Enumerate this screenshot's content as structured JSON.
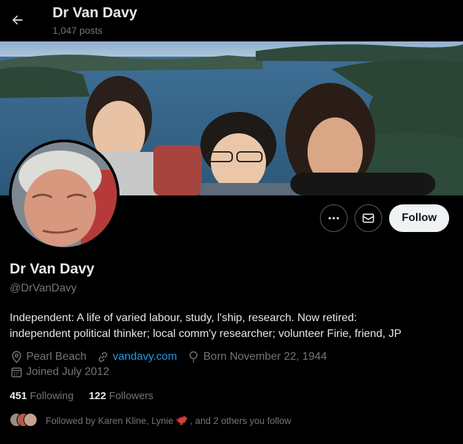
{
  "header": {
    "title": "Dr Van Davy",
    "post_count": "1,047 posts"
  },
  "profile": {
    "name": "Dr Van Davy",
    "handle": "@DrVanDavy",
    "bio_line1": "Independent: A life of varied labour, study, l'ship, research. Now retired:",
    "bio_line2": "independent political thinker; local comm'y researcher; volunteer Firie, friend, JP",
    "location": "Pearl Beach",
    "website": "vandavy.com",
    "birthday": "Born November 22, 1944",
    "joined": "Joined July 2012"
  },
  "actions": {
    "follow_label": "Follow"
  },
  "stats": {
    "following_count": "451",
    "following_label": "Following",
    "followers_count": "122",
    "followers_label": "Followers"
  },
  "followed_by": {
    "prefix": "Followed by Karen Kline, Lynie",
    "suffix": ", and 2 others you follow"
  },
  "colors": {
    "background": "#000000",
    "text_primary": "#e7e9ea",
    "text_secondary": "#71767b",
    "link": "#1d9bf0",
    "follow_button_bg": "#eff3f4"
  },
  "icons": [
    "back-arrow-icon",
    "more-icon",
    "message-icon",
    "location-icon",
    "link-icon",
    "birthday-icon",
    "calendar-icon",
    "bird-emoji-icon"
  ]
}
